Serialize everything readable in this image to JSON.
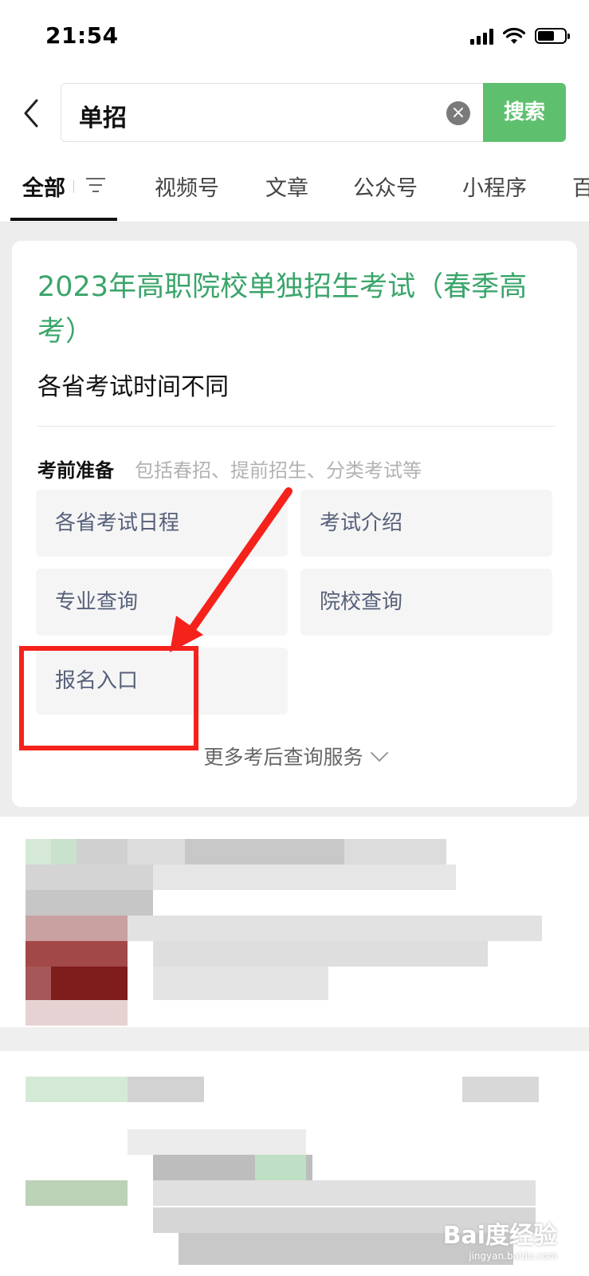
{
  "status_bar": {
    "time": "21:54"
  },
  "search": {
    "query": "单招",
    "button_label": "搜索"
  },
  "tabs": [
    {
      "label": "全部"
    },
    {
      "label": "视频号"
    },
    {
      "label": "文章"
    },
    {
      "label": "公众号"
    },
    {
      "label": "小程序"
    },
    {
      "label": "百"
    }
  ],
  "card": {
    "title": "2023年高职院校单独招生考试（春季高考）",
    "subtitle": "各省考试时间不同",
    "prep_heading": "考前准备",
    "prep_description": "包括春招、提前招生、分类考试等",
    "buttons": [
      {
        "label": "各省考试日程"
      },
      {
        "label": "考试介绍"
      },
      {
        "label": "专业查询"
      },
      {
        "label": "院校查询"
      },
      {
        "label": "报名入口"
      }
    ],
    "more_label": "更多考后查询服务"
  },
  "watermark": {
    "brand": "Bai度经验",
    "url": "jingyan.baidu.com"
  },
  "colors": {
    "accent_green": "#5ec06e",
    "title_green": "#3aa56a",
    "annotation_red": "#f5221c"
  }
}
